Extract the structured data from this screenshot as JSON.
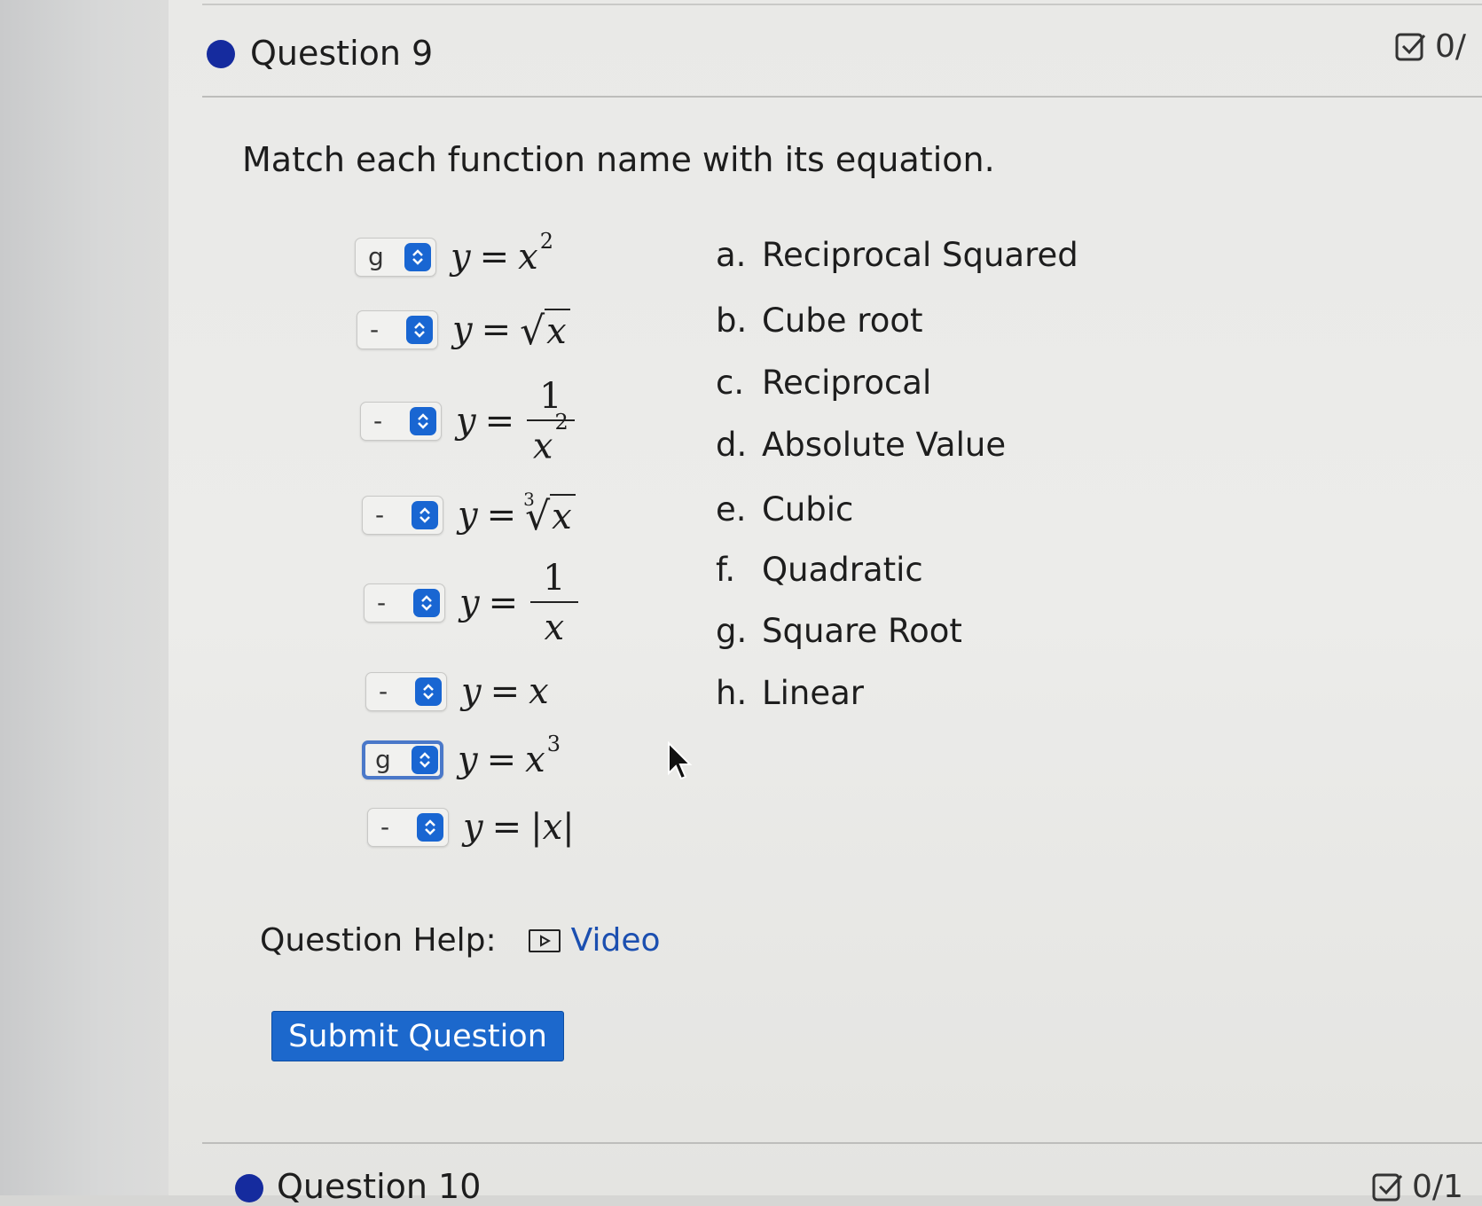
{
  "question9": {
    "title": "Question 9",
    "score": "0/",
    "prompt": "Match each function name with its equation."
  },
  "matches": [
    {
      "selected": "g",
      "equation": "y = x^2"
    },
    {
      "selected": "-",
      "equation": "y = sqrt(x)"
    },
    {
      "selected": "-",
      "equation": "y = 1/x^2"
    },
    {
      "selected": "-",
      "equation": "y = cbrt(x)"
    },
    {
      "selected": "-",
      "equation": "y = 1/x"
    },
    {
      "selected": "-",
      "equation": "y = x"
    },
    {
      "selected": "g",
      "equation": "y = x^3"
    },
    {
      "selected": "-",
      "equation": "y = |x|"
    }
  ],
  "eq_text": {
    "y": "y",
    "eq": "=",
    "x": "x",
    "one": "1",
    "two": "2",
    "three": "3",
    "bar": "|"
  },
  "options": [
    {
      "letter": "a.",
      "label": "Reciprocal Squared"
    },
    {
      "letter": "b.",
      "label": "Cube root"
    },
    {
      "letter": "c.",
      "label": "Reciprocal"
    },
    {
      "letter": "d.",
      "label": "Absolute Value"
    },
    {
      "letter": "e.",
      "label": "Cubic"
    },
    {
      "letter": "f.",
      "label": "Quadratic"
    },
    {
      "letter": "g.",
      "label": "Square Root"
    },
    {
      "letter": "h.",
      "label": "Linear"
    }
  ],
  "help": {
    "label": "Question Help:",
    "video_label": "Video"
  },
  "submit_label": "Submit Question",
  "question10": {
    "title": "Question 10",
    "score": "0/1"
  },
  "colors": {
    "accent": "#1c68cc",
    "bullet": "#152b9e",
    "link": "#1b4fb0",
    "focus": "#4a78c9"
  },
  "icons": [
    "question-bullet-icon",
    "score-check-icon",
    "stepper-icon",
    "video-play-icon",
    "mouse-cursor-icon"
  ]
}
